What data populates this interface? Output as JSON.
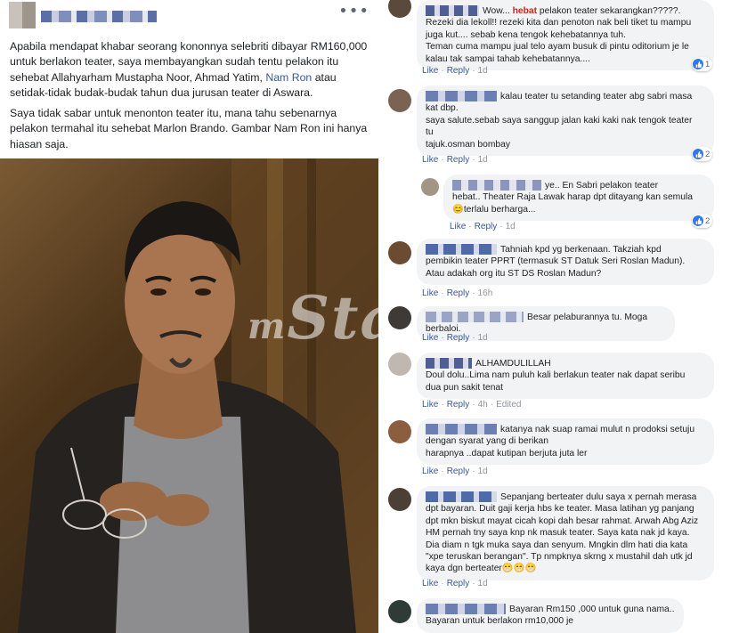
{
  "post": {
    "paragraph1_a": "Apabila mendapat khabar seorang kononnya selebriti dibayar RM160,000 untuk berlakon teater, saya membayangkan sudah tentu pelakon itu sehebat Allahyarham Mustapha Noor, Ahmad Yatim, ",
    "paragraph1_link": "Nam Ron",
    "paragraph1_b": " atau setidak-tidak budak-budak tahun dua jurusan teater di Aswara.",
    "paragraph2": "Saya tidak sabar untuk menonton teater itu, mana tahu sebenarnya pelakon termahal itu sehebat Marlon Brando. Gambar Nam Ron ini hanya hiasan saja.",
    "more_label": "•••",
    "watermark_m": "m",
    "watermark_word": "Star"
  },
  "comments": [
    {
      "text_lines": [
        "Wow... |hebat| pelakon teater sekarangkan?????.",
        "Rezeki dia lekoll!! rezeki kita dan penoton nak beli tiket tu mampu",
        "juga kut.... sebab kena tengok kehebatannya tuh.",
        "Teman cuma mampu jual telo ayam busuk di pintu oditorium je le",
        "kalau tak sampai tahab kehebatannya...."
      ],
      "actions": {
        "like": "Like",
        "reply": "Reply",
        "time": "1d"
      },
      "reactions": "1"
    },
    {
      "text_lines": [
        "kalau teater tu setanding teater abg sabri masa",
        "kat dbp.",
        "saya salute.sebab saya sanggup jalan kaki kaki nak tengok teater",
        "tu",
        "tajuk.osman bombay"
      ],
      "actions": {
        "like": "Like",
        "reply": "Reply",
        "time": "1d"
      },
      "reactions": "2"
    },
    {
      "text_lines": [
        "ye.. En Sabri pelakon teater",
        "hebat.. Theater Raja Lawak harap dpt ditayang kan semula",
        "😊terlalu berharga..."
      ],
      "actions": {
        "like": "Like",
        "reply": "Reply",
        "time": "1d"
      },
      "reactions": "2"
    },
    {
      "text_lines": [
        "Tahniah kpd yg berkenaan. Takziah kpd",
        "pembikin teater PPRT (termasuk ST Datuk Seri Roslan Madun).",
        "Atau adakah org itu ST DS Roslan Madun?"
      ],
      "actions": {
        "like": "Like",
        "reply": "Reply",
        "time": "16h"
      }
    },
    {
      "text_lines": [
        "Besar pelaburannya tu. Moga berbaloi."
      ],
      "actions": {
        "like": "Like",
        "reply": "Reply",
        "time": "1d"
      }
    },
    {
      "text_lines": [
        "ALHAMDULILLAH",
        "Doul dolu..Lima nam puluh kali berlakun teater nak dapat seribu",
        "dua pun sakit tenat"
      ],
      "actions": {
        "like": "Like",
        "reply": "Reply",
        "time": "4h",
        "edited": "Edited"
      }
    },
    {
      "text_lines": [
        "katanya nak suap ramai mulut n prodoksi setuju",
        "dengan syarat yang di berikan",
        "harapnya ..dapat kutipan berjuta juta ler"
      ],
      "actions": {
        "like": "Like",
        "reply": "Reply",
        "time": "1d"
      }
    },
    {
      "text_lines": [
        "Sepanjang berteater dulu saya x pernah merasa",
        "dpt bayaran. Duit gaji kerja hbs ke teater. Masa latihan yg panjang",
        "dpt mkn biskut mayat cicah kopi dah besar rahmat. Arwah Abg Aziz",
        "HM pernah tny saya knp nk masuk teater. Saya kata nak jd kaya.",
        "Dia diam n tgk muka saya dan senyum. Mngkin dlm hati dia kata",
        "\"xpe teruskan berangan\". Tp nmpknya skrng x mustahil dah utk jd",
        "kaya dgn berteater😁😁😁"
      ],
      "actions": {
        "like": "Like",
        "reply": "Reply",
        "time": "1d"
      }
    },
    {
      "text_lines": [
        "Bayaran Rm150 ,000 untuk guna nama..",
        "Bayaran untuk berlakon rm10,000 je"
      ],
      "actions": {}
    }
  ],
  "colors": {
    "bubble": "#f2f3f5",
    "link": "#385898",
    "meta": "#90949c",
    "like_blue": "#3578e5",
    "keyword_red": "#bb2a22"
  },
  "icons": [
    "like-icon",
    "more-options-icon"
  ]
}
